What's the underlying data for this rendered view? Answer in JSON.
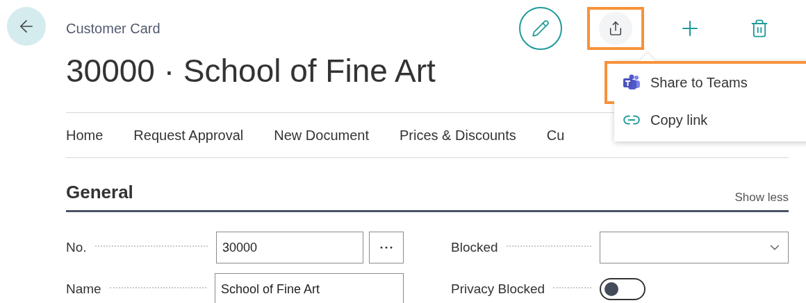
{
  "header": {
    "breadcrumb": "Customer Card",
    "title": "30000 · School of Fine Art"
  },
  "actions": [
    {
      "kind": "edit"
    },
    {
      "kind": "share",
      "highlighted": true
    },
    {
      "kind": "new"
    },
    {
      "kind": "delete"
    }
  ],
  "nav_tabs": [
    "Home",
    "Request Approval",
    "New Document",
    "Prices & Discounts",
    "Cu"
  ],
  "share_menu": [
    {
      "kind": "teams",
      "label": "Share to Teams",
      "highlighted": true
    },
    {
      "kind": "link",
      "label": "Copy link",
      "highlighted": false
    }
  ],
  "section": {
    "title": "General",
    "toggle_link": "Show less"
  },
  "fields": [
    {
      "label": "No.",
      "kind": "lookup",
      "value": "30000"
    },
    {
      "label": "Blocked",
      "kind": "select"
    },
    {
      "label": "Name",
      "kind": "text",
      "value": "School of Fine Art"
    },
    {
      "label": "Privacy Blocked",
      "kind": "switch",
      "on": false
    }
  ]
}
